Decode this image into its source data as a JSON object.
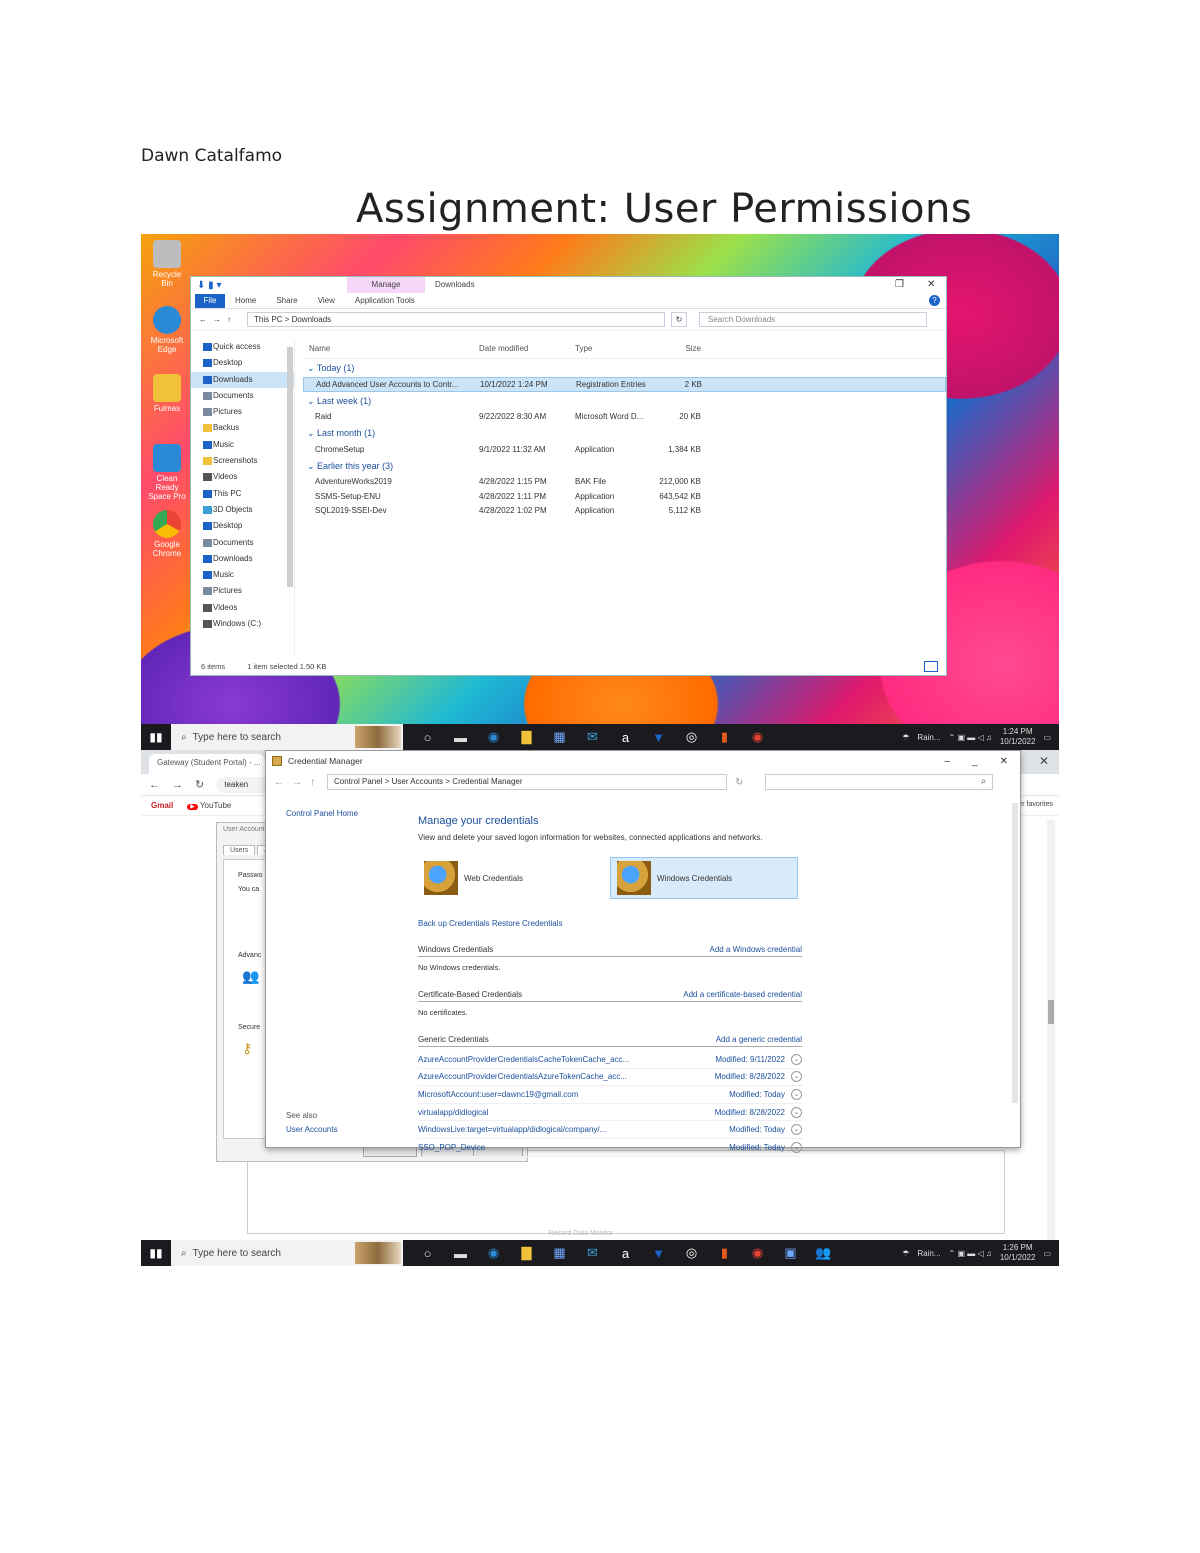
{
  "document": {
    "author": "Dawn Catalfamo",
    "title": "Assignment: User Permissions"
  },
  "desktop1": {
    "icons": [
      {
        "label": "Recycle Bin",
        "color": "#bdbdbd"
      },
      {
        "label": "Microsoft Edge",
        "color": "#2a8ad6"
      },
      {
        "label": "Fuimas",
        "color": "#f2c13a"
      },
      {
        "label": "Clean Ready Space Pro",
        "color": "#2a8ad6"
      },
      {
        "label": "Google Chrome",
        "color": "#e94335"
      }
    ],
    "explorer": {
      "manage_tab": "Manage",
      "window_title": "Downloads",
      "ribbon_tabs": [
        "File",
        "Home",
        "Share",
        "View",
        "Application Tools"
      ],
      "address": "This PC  >  Downloads",
      "search_placeholder": "Search Downloads",
      "nav_items": [
        "Quick access",
        "Desktop",
        "Downloads",
        "Documents",
        "Pictures",
        "Backus",
        "Music",
        "Screenshots",
        "Videos",
        "This PC",
        "3D Objects",
        "Desktop",
        "Documents",
        "Downloads",
        "Music",
        "Pictures",
        "Videos",
        "Windows (C:)"
      ],
      "columns": [
        "Name",
        "Date modified",
        "Type",
        "Size"
      ],
      "groups": [
        {
          "label": "Today (1)",
          "rows": [
            {
              "name": "Add Advanced User Accounts to Contr...",
              "date": "10/1/2022 1:24 PM",
              "type": "Registration Entries",
              "size": "2 KB",
              "selected": true
            }
          ]
        },
        {
          "label": "Last week (1)",
          "rows": [
            {
              "name": "Raid",
              "date": "9/22/2022 8:30 AM",
              "type": "Microsoft Word D...",
              "size": "20 KB",
              "selected": false
            }
          ]
        },
        {
          "label": "Last month (1)",
          "rows": [
            {
              "name": "ChromeSetup",
              "date": "9/1/2022 11:32 AM",
              "type": "Application",
              "size": "1,384 KB",
              "selected": false
            }
          ]
        },
        {
          "label": "Earlier this year (3)",
          "rows": [
            {
              "name": "AdventureWorks2019",
              "date": "4/28/2022 1:15 PM",
              "type": "BAK File",
              "size": "212,000 KB",
              "selected": false
            },
            {
              "name": "SSMS-Setup-ENU",
              "date": "4/28/2022 1:11 PM",
              "type": "Application",
              "size": "643,542 KB",
              "selected": false
            },
            {
              "name": "SQL2019-SSEI-Dev",
              "date": "4/28/2022 1:02 PM",
              "type": "Application",
              "size": "5,112 KB",
              "selected": false
            }
          ]
        }
      ],
      "status_items": "6 items",
      "status_selected": "1 item selected  1.50 KB"
    }
  },
  "taskbar1": {
    "search": "Type here to search",
    "apps": [
      "○",
      "▬",
      "◉",
      "▇",
      "▦",
      "✉",
      "a",
      "▼",
      "◎",
      "▮",
      "◉"
    ],
    "weather": "Rain...",
    "time": "1:24 PM",
    "date": "10/1/2022"
  },
  "desktop2": {
    "browser_tab": "Gateway (Student Portal) - ...",
    "url": "teaken",
    "bookmarks": [
      "Gmail",
      "YouTube"
    ],
    "bookmarks_right": "Other favorites",
    "background_doc_strip": "Record Data Monitor",
    "properties_window": {
      "title": "User Accounts",
      "tabs": [
        "Users",
        "Adv"
      ],
      "labels": [
        "Passwo",
        "You ca",
        "Advanc",
        "Secure"
      ]
    },
    "credential_manager": {
      "title": "Credential Manager",
      "address": "Control Panel  >  User Accounts  >  Credential Manager",
      "left_home": "Control Panel Home",
      "see_also": "See also",
      "user_accounts": "User Accounts",
      "heading": "Manage your credentials",
      "subtitle": "View and delete your saved logon information for websites, connected applications and networks.",
      "web_credentials": "Web Credentials",
      "windows_credentials": "Windows Credentials",
      "backup_links": "Back up Credentials    Restore Credentials",
      "win_section": "Windows Credentials",
      "win_add": "Add a Windows credential",
      "win_none": "No Windows credentials.",
      "cert_section": "Certificate-Based Credentials",
      "cert_add": "Add a certificate-based credential",
      "cert_none": "No certificates.",
      "generic_section": "Generic Credentials",
      "generic_add": "Add a generic credential",
      "generic": [
        {
          "name": "AzureAccountProviderCredentialsCacheTokenCache_acc...",
          "modified": "Modified:  9/11/2022"
        },
        {
          "name": "AzureAccountProviderCredentialsAzureTokenCache_acc...",
          "modified": "Modified:  8/28/2022"
        },
        {
          "name": "MicrosoftAccount:user=dawnc19@gmail.com",
          "modified": "Modified:  Today"
        },
        {
          "name": "virtualapp/didlogical",
          "modified": "Modified:  8/28/2022"
        },
        {
          "name": "WindowsLive:target=virtualapp/didlogical/company/...",
          "modified": "Modified:  Today"
        },
        {
          "name": "SSO_POP_Device",
          "modified": "Modified:  Today"
        }
      ]
    }
  },
  "taskbar2": {
    "search": "Type here to search",
    "apps": [
      "○",
      "▬",
      "◉",
      "▇",
      "▦",
      "✉",
      "a",
      "▼",
      "◎",
      "▮",
      "◉",
      "▣",
      "👥"
    ],
    "weather": "Rain...",
    "time": "1:26 PM",
    "date": "10/1/2022"
  }
}
